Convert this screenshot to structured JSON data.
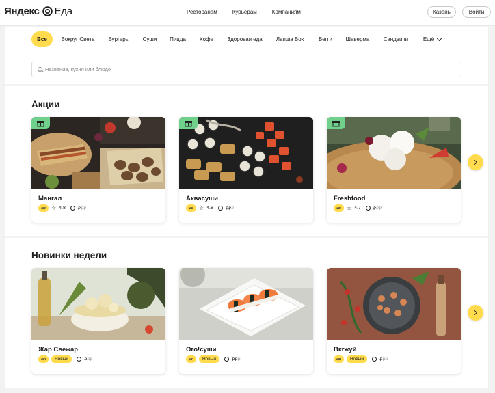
{
  "header": {
    "brand": "Яндекс",
    "product": "Еда",
    "nav": [
      "Ресторанам",
      "Курьерам",
      "Компаниям"
    ],
    "city_button": "Казань",
    "login_button": "Войти"
  },
  "categories": [
    {
      "label": "Все",
      "active": true
    },
    {
      "label": "Вокруг Света"
    },
    {
      "label": "Бургеры"
    },
    {
      "label": "Суши"
    },
    {
      "label": "Пицца"
    },
    {
      "label": "Кофе"
    },
    {
      "label": "Здоровая еда"
    },
    {
      "label": "Лапша Вок"
    },
    {
      "label": "Вегги"
    },
    {
      "label": "Шаверма"
    },
    {
      "label": "Сэндвичи"
    },
    {
      "label": "Ещё"
    }
  ],
  "search": {
    "placeholder": "Название, кухня или блюдо"
  },
  "sections": [
    {
      "title": "Акции",
      "cards": [
        {
          "name": "Мангал",
          "tag": "ஸ",
          "rating": "4.8",
          "price": "₽",
          "price_dim": "₽₽"
        },
        {
          "name": "Аквасуши",
          "tag": "ஸ",
          "rating": "4.8",
          "price": "₽₽",
          "price_dim": "₽"
        },
        {
          "name": "Freshfood",
          "tag": "ஸ",
          "rating": "4.7",
          "price": "₽",
          "price_dim": "₽₽"
        }
      ]
    },
    {
      "title": "Новинки недели",
      "cards": [
        {
          "name": "Жар Свежар",
          "tag": "ஸ",
          "badge": "Новый",
          "price": "₽",
          "price_dim": "₽₽"
        },
        {
          "name": "Ого!суши",
          "tag": "ஸ",
          "badge": "Новый",
          "price": "₽₽",
          "price_dim": "₽"
        },
        {
          "name": "Вкгжуй",
          "tag": "ஸ",
          "badge": "Новый",
          "price": "₽",
          "price_dim": "₽₽"
        }
      ]
    }
  ],
  "colors": {
    "accent": "#ffdb4d",
    "promo": "#6fd18b"
  }
}
